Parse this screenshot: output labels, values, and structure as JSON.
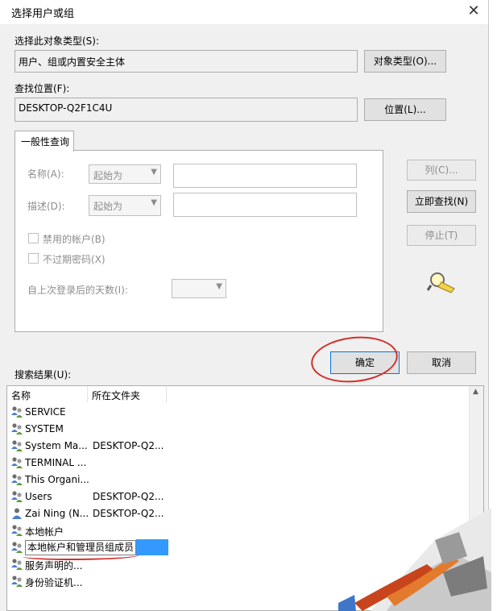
{
  "window": {
    "title": "选择用户或组",
    "close_glyph": "✕"
  },
  "object_type": {
    "label": "选择此对象类型(S):",
    "value": "用户、组或内置安全主体",
    "button": "对象类型(O)..."
  },
  "location": {
    "label": "查找位置(F):",
    "value": "DESKTOP-Q2F1C4U",
    "button": "位置(L)..."
  },
  "query": {
    "tab": "一般性查询",
    "name_label": "名称(A):",
    "name_mode": "起始为",
    "desc_label": "描述(D):",
    "desc_mode": "起始为",
    "disabled_accounts": "禁用的帐户(B)",
    "non_expiring": "不过期密码(X)",
    "days_label": "自上次登录后的天数(I):"
  },
  "side_buttons": {
    "columns": "列(C)...",
    "find_now": "立即查找(N)",
    "stop": "停止(T)"
  },
  "actions": {
    "ok": "确定",
    "cancel": "取消"
  },
  "results": {
    "label": "搜索结果(U):",
    "columns": [
      "名称",
      "所在文件夹"
    ],
    "rows": [
      {
        "name": "SERVICE",
        "folder": "",
        "icon": "group-icon"
      },
      {
        "name": "SYSTEM",
        "folder": "",
        "icon": "group-icon"
      },
      {
        "name": "System Ma...",
        "folder": "DESKTOP-Q2...",
        "icon": "group-icon"
      },
      {
        "name": "TERMINAL ...",
        "folder": "",
        "icon": "group-icon"
      },
      {
        "name": "This Organi...",
        "folder": "",
        "icon": "group-icon"
      },
      {
        "name": "Users",
        "folder": "DESKTOP-Q2...",
        "icon": "group-icon"
      },
      {
        "name": "Zai Ning (N...",
        "folder": "DESKTOP-Q2...",
        "icon": "user-icon"
      },
      {
        "name": "本地帐户",
        "folder": "",
        "icon": "group-icon"
      },
      {
        "name": "本地帐户和管理员组成员",
        "folder": "",
        "icon": "group-icon",
        "selected": true
      },
      {
        "name": "服务声明的...",
        "folder": "",
        "icon": "group-icon"
      },
      {
        "name": "身份验证机...",
        "folder": "",
        "icon": "group-icon"
      }
    ]
  },
  "colors": {
    "accent": "#0078d7",
    "selection": "#3399ff",
    "annotation": "#d2302b"
  }
}
